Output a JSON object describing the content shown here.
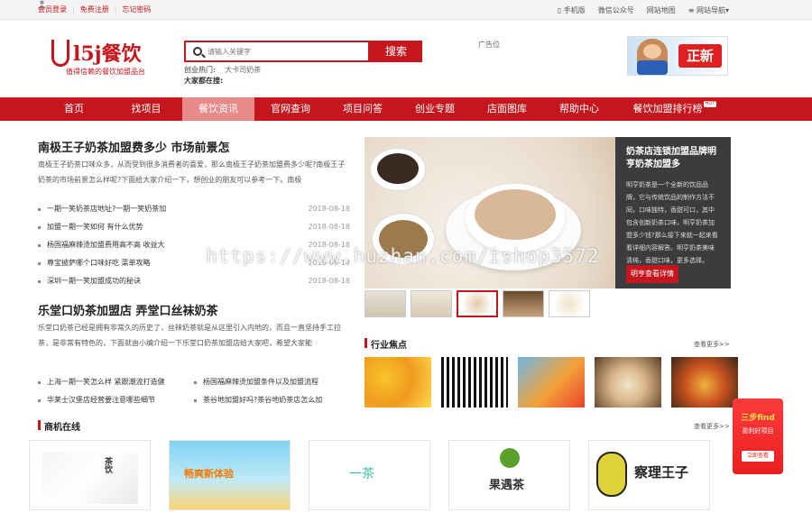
{
  "topbar": {
    "links_left": [
      "会员登录",
      "免费注册",
      "忘记密码"
    ],
    "links_right": [
      "手机版",
      "微信公众号",
      "网站地图",
      "网站导航"
    ]
  },
  "header": {
    "logo_main": "l5j餐饮",
    "logo_sub": "值得信赖的餐饮加盟品台",
    "search_placeholder": "请输入关键字",
    "search_button": "搜索",
    "hot_label": "创业热门:",
    "hot_keyword": "大卡司奶茶",
    "searching_label": "大家都在搜:",
    "ad_text": "广告位",
    "ad_banner_text": "正新"
  },
  "nav": {
    "items": [
      "首页",
      "找项目",
      "餐饮资讯",
      "官网查询",
      "项目问答",
      "创业专题",
      "店面图库",
      "帮助中心",
      "餐饮加盟排行榜"
    ],
    "active_index": 2,
    "hot_badge": "HOT"
  },
  "article1": {
    "title": "南极王子奶茶加盟费多少 市场前景怎",
    "summary": "南极王子奶茶口味众多，从而受到很多消费者的喜爱，那么南极王子奶茶加盟费多少呢?南极王子奶茶的市场前景怎么样呢?下面给大家介绍一下，想创业的朋友可以参考一下。南极",
    "list": [
      {
        "text": "一期一笑奶茶店地址?一期一笑奶茶加",
        "date": "2018-08-18"
      },
      {
        "text": "加盟一期一笑如何 有什么优势",
        "date": "2018-08-18"
      },
      {
        "text": "杨国福麻辣烫加盟费用高不高 收益大",
        "date": "2018-08-18"
      },
      {
        "text": "尊宝披萨哪个口味好吃 菜单攻略",
        "date": "2018-08-18"
      },
      {
        "text": "深圳一期一笑加盟成功的秘诀",
        "date": "2018-08-18"
      }
    ]
  },
  "article2": {
    "title": "乐堂口奶茶加盟店 弄堂口丝袜奶茶",
    "summary": "乐堂口奶茶已经是拥有非常久的历史了，丝袜奶茶就是从这里引入内地的，而且一直坚持手工拉茶，是非常有特色的，下面就由小编介绍一下乐堂口奶茶加盟店给大家吧，希望大家能",
    "list": [
      "上海一期一笑怎么样 紧跟潮流打造健",
      "杨国福麻辣烫加盟条件以及加盟流程",
      "华莱士汉堡店经营要注意哪些细节",
      "茶谷地加盟好吗?茶谷地奶茶店怎么加"
    ]
  },
  "slider": {
    "panel_title": "奶茶店连锁加盟品牌明亨奶茶加盟多",
    "panel_desc": "明亨奶茶是一个全新的饮品品牌，它与传统饮品的制作方法不同，口味独特，香甜可口，其中包含创新奶茶口味，明亨奶茶加盟多少钱?那么接下来就一起来看看详细内容解答。明亨奶茶美味清纯，香甜口味，更多选择。",
    "panel_button": "明亨查看详情"
  },
  "industry": {
    "title": "行业焦点",
    "more": "查看更多>>"
  },
  "business": {
    "title": "商机在线",
    "more": "查看更多>>",
    "cards": [
      "茶饮",
      "畅爽新体验",
      "一茶",
      "果遇茶",
      "察理王子"
    ]
  },
  "watermark": "https://www.huzhan.com/ishop3572",
  "float_ad": {
    "line1": "三步find",
    "line2": "盈利好项目",
    "button": "立即查看"
  },
  "colors": {
    "brand": "#c4161c",
    "nav_active": "#e88a8a"
  }
}
